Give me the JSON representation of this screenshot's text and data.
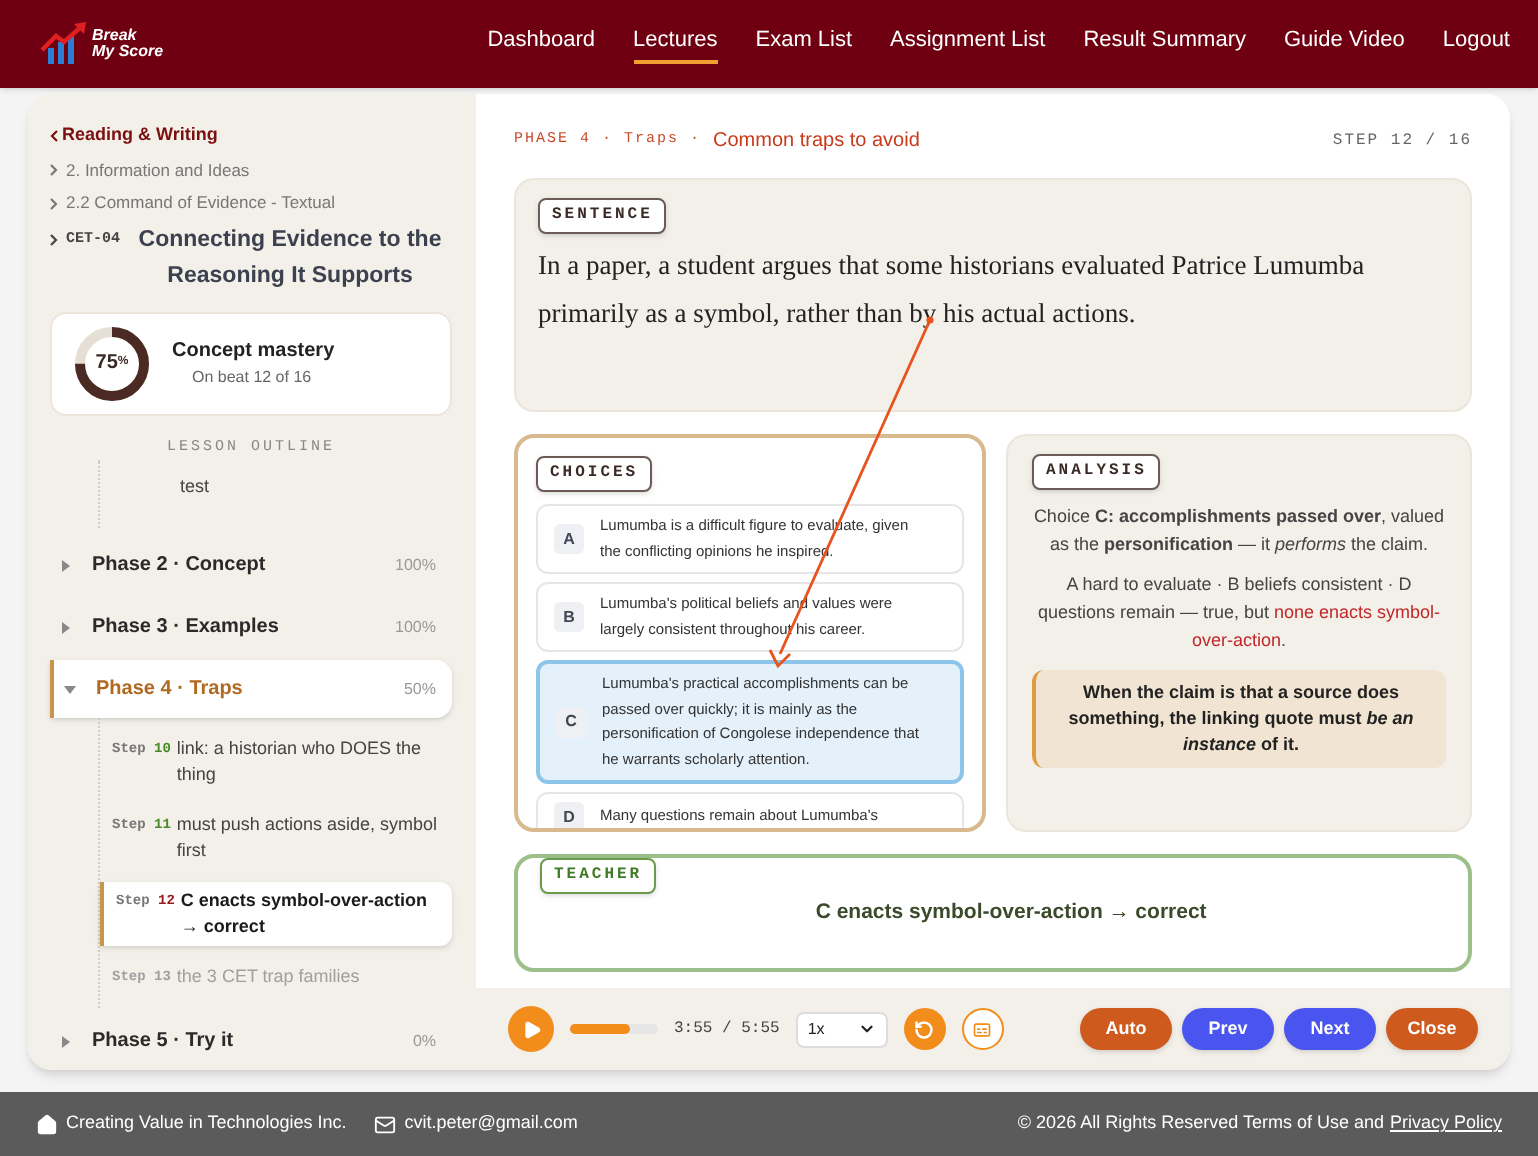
{
  "logo": {
    "line_1": "Break",
    "line_2": "My Score"
  },
  "nav": [
    {
      "label": "Dashboard",
      "selected": false
    },
    {
      "label": "Lectures",
      "selected": true
    },
    {
      "label": "Exam List",
      "selected": false
    },
    {
      "label": "Assignment List",
      "selected": false
    },
    {
      "label": "Result Summary",
      "selected": false
    },
    {
      "label": "Guide Video",
      "selected": false
    },
    {
      "label": "Logout",
      "selected": false
    }
  ],
  "sidebar": {
    "back_link": "Reading & Writing",
    "breadcrumbs": [
      "2. Information and Ideas",
      "2.2 Command of Evidence - Textual"
    ],
    "lesson_code": "CET-04",
    "lesson_title": "Connecting Evidence to the Reasoning It Supports",
    "mastery": {
      "percent": "75",
      "unit": "%",
      "level": 0.75,
      "title": "Concept mastery",
      "subtitle": "On beat 12 of 16"
    },
    "outline_title": "LESSON OUTLINE",
    "outline_fragment": "test",
    "phases": [
      {
        "label": "Phase 2 · Concept",
        "percent": "100%",
        "expanded": false,
        "selected": false
      },
      {
        "label": "Phase 3 · Examples",
        "percent": "100%",
        "expanded": false,
        "selected": false
      },
      {
        "label": "Phase 4 · Traps",
        "percent": "50%",
        "expanded": true,
        "selected": true,
        "children": [
          {
            "prefix": "Step",
            "number": "10",
            "text": "link: a historian who DOES the thing",
            "kind": "done",
            "selected": false
          },
          {
            "prefix": "Step",
            "number": "11",
            "text": "must push actions aside, symbol first",
            "kind": "done",
            "selected": false
          },
          {
            "prefix": "Step",
            "number": "12",
            "text": "C enacts symbol-over-action → correct",
            "kind": "current",
            "selected": true
          },
          {
            "prefix": "Step",
            "number": "13",
            "text": "the 3 CET trap families",
            "kind": "upcoming",
            "selected": false
          }
        ]
      },
      {
        "label": "Phase 5 · Try it",
        "percent": "0%",
        "expanded": false,
        "selected": false
      }
    ]
  },
  "main": {
    "phase_tag": "PHASE 4 · Traps ·",
    "phase_title": "Common traps to avoid",
    "step_counter": "STEP 12 / 16",
    "sentence": {
      "label": "SENTENCE",
      "text": "In a paper, a student argues that some historians evaluated Patrice Lumumba primarily as a  symbol, rather than by his actual actions."
    },
    "choices": {
      "label": "CHOICES",
      "items": [
        {
          "letter": "A",
          "text": "Lumumba is a difficult figure to evaluate, given the conflicting opinions he inspired.",
          "selected": false
        },
        {
          "letter": "B",
          "text": "Lumumba's political beliefs and values were largely consistent throughout his career.",
          "selected": false
        },
        {
          "letter": "C",
          "text": "Lumumba's practical accomplishments can be passed over quickly; it is mainly as the personification of Congolese independence that he warrants scholarly attention.",
          "selected": true
        },
        {
          "letter": "D",
          "text": "Many questions remain about Lumumba's",
          "selected": false
        }
      ]
    },
    "analysis": {
      "label": "ANALYSIS",
      "paragraph_1": "Choice **C: accomplishments passed over**, valued as the **personification** — it *performs* the claim.",
      "paragraph_2": {
        "text": "A hard to evaluate · B beliefs consistent · D questions remain — true, but ",
        "highlight": "none enacts symbol-over-action",
        "end": "."
      },
      "callout": "When the claim is that a source does something, the linking quote must *be an instance* of it."
    },
    "teacher": {
      "label": "TEACHER",
      "text": "C enacts symbol-over-action → correct"
    }
  },
  "player": {
    "level": 0.68,
    "time": "3:55 / 5:55",
    "speed": "1x",
    "buttons": [
      {
        "label": "Auto",
        "kind": "accent"
      },
      {
        "label": "Prev",
        "kind": "primary"
      },
      {
        "label": "Next",
        "kind": "primary"
      },
      {
        "label": "Close",
        "kind": "accent"
      }
    ]
  },
  "footer": {
    "company": "Creating Value in Technologies Inc.",
    "email": "cvit.peter@gmail.com",
    "copyright": "© 2026 All Rights Reserved Terms of Use and",
    "privacy_link": "Privacy Policy"
  }
}
